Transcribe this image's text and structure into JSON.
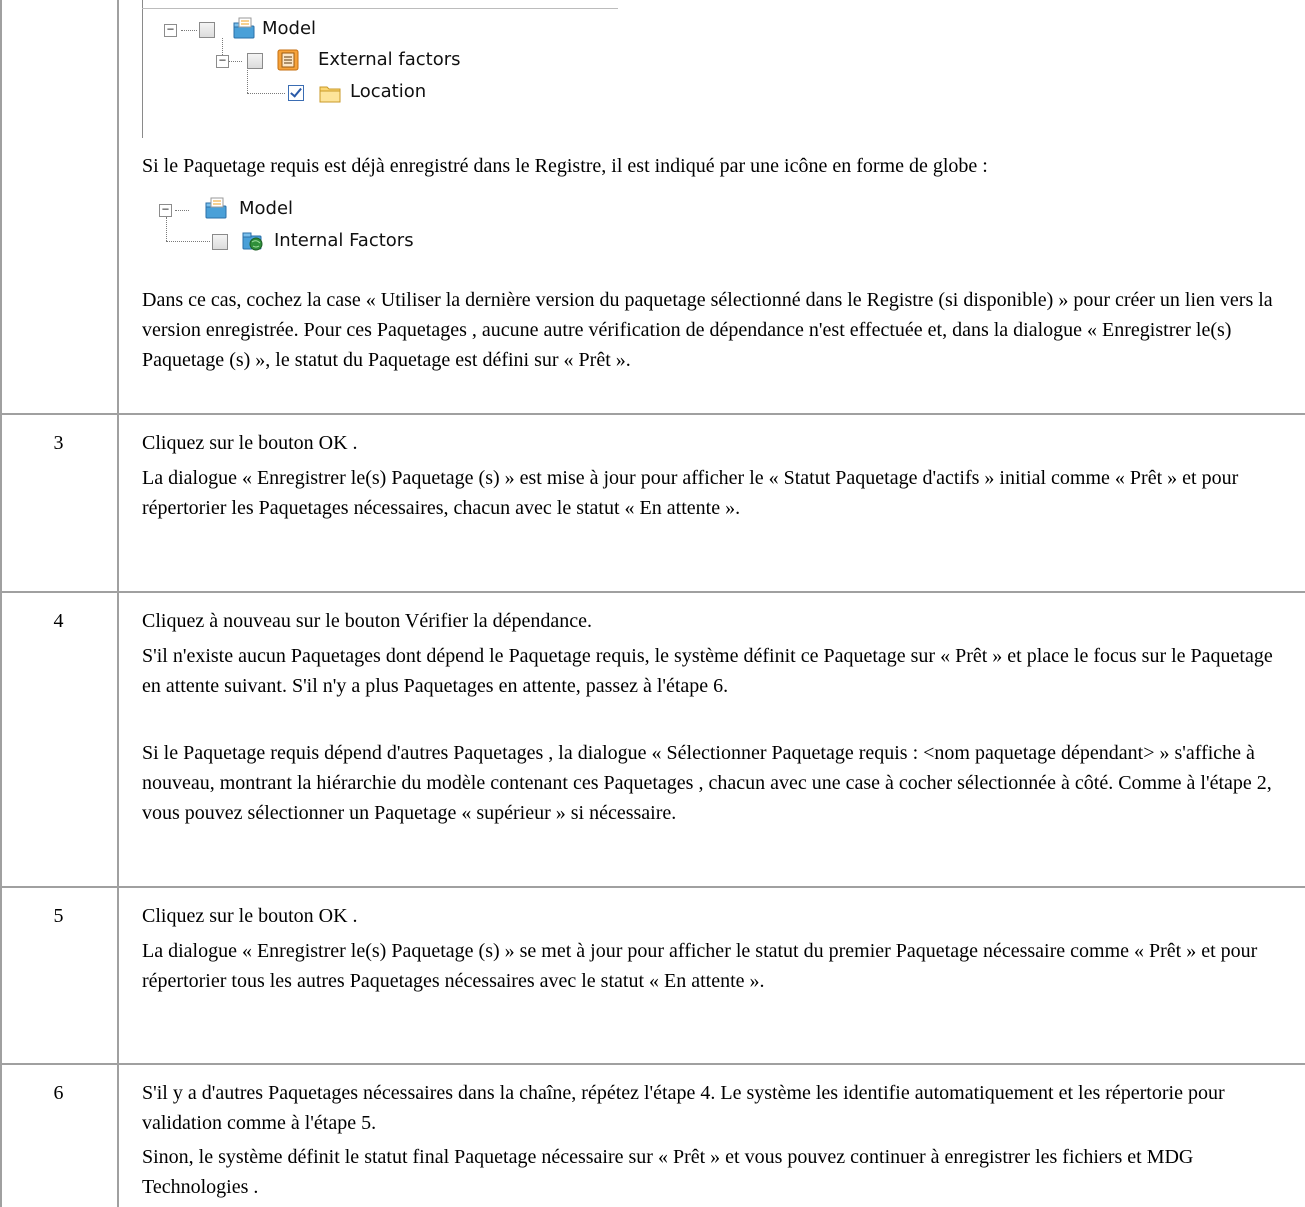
{
  "tree1": {
    "items": [
      {
        "label": "Model",
        "icon": "model-package-icon",
        "checked": false,
        "expander": "−"
      },
      {
        "label": "External factors",
        "icon": "element-list-icon",
        "checked": false,
        "expander": "−"
      },
      {
        "label": "Location",
        "icon": "folder-icon",
        "checked": true
      }
    ]
  },
  "intro_paragraph": "Si le Paquetage requis est déjà enregistré dans le Registre, il est indiqué par une icône en forme de globe :",
  "tree2": {
    "items": [
      {
        "label": "Model",
        "icon": "model-package-icon",
        "expander": "−"
      },
      {
        "label": "Internal Factors",
        "icon": "globe-package-icon",
        "checked": false
      }
    ]
  },
  "step2_paragraph": "Dans ce cas, cochez la case « Utiliser la dernière version du paquetage sélectionné dans le Registre (si disponible) » pour créer un lien vers la version enregistrée. Pour ces Paquetages , aucune autre vérification de dépendance n'est effectuée et, dans la dialogue « Enregistrer le(s) Paquetage (s) », le statut du Paquetage est défini sur « Prêt ».",
  "steps": [
    {
      "number": "3",
      "lines": [
        "Cliquez sur le bouton OK .",
        "La dialogue « Enregistrer le(s) Paquetage (s) » est mise à jour pour afficher le « Statut Paquetage d'actifs » initial comme « Prêt » et pour répertorier les Paquetages nécessaires, chacun avec le statut « En attente »."
      ]
    },
    {
      "number": "4",
      "lines": [
        "Cliquez à nouveau sur le bouton Vérifier la dépendance.",
        "S'il n'existe aucun Paquetages dont dépend le Paquetage requis, le système définit ce Paquetage sur « Prêt » et place le focus sur le Paquetage en attente suivant. S'il n'y a plus Paquetages en attente, passez à l'étape 6.",
        "Si le Paquetage requis dépend d'autres Paquetages , la dialogue « Sélectionner Paquetage requis : <nom paquetage dépendant> » s'affiche à nouveau, montrant la hiérarchie du modèle contenant ces Paquetages , chacun avec une case à cocher sélectionnée à côté. Comme à l'étape 2, vous pouvez sélectionner un Paquetage « supérieur » si nécessaire."
      ]
    },
    {
      "number": "5",
      "lines": [
        "Cliquez sur le bouton OK .",
        "La dialogue « Enregistrer le(s) Paquetage (s) » se met à jour pour afficher le statut du premier Paquetage nécessaire comme « Prêt » et pour répertorier tous les autres Paquetages nécessaires avec le statut « En attente »."
      ]
    },
    {
      "number": "6",
      "lines": [
        "S'il y a d'autres Paquetages nécessaires dans la chaîne, répétez l'étape 4. Le système les identifie automatiquement et les répertorie pour validation comme à l'étape 5.",
        "Sinon, le système définit le statut final Paquetage nécessaire sur « Prêt » et vous pouvez continuer à enregistrer les fichiers et MDG Technologies ."
      ]
    }
  ],
  "colors": {
    "border": "#a0a0a0",
    "text": "#000000"
  }
}
